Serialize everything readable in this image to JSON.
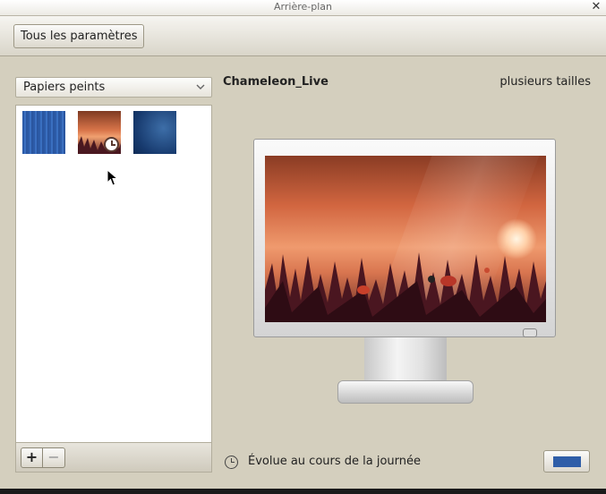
{
  "window": {
    "title": "Arrière-plan"
  },
  "toolbar": {
    "all_settings_label": "Tous les paramètres"
  },
  "sidebar": {
    "category_selected": "Papiers peints",
    "thumbnails": [
      {
        "name": "blue-stripes-wallpaper"
      },
      {
        "name": "chameleon-live-wallpaper",
        "selected": true,
        "time_based": true
      },
      {
        "name": "blue-night-wallpaper"
      }
    ],
    "add_label": "+",
    "remove_label": "−"
  },
  "preview": {
    "name": "Chameleon_Live",
    "size_text": "plusieurs tailles",
    "status_text": "Évolue au cours de la journée",
    "status_icon": "clock-icon"
  },
  "colors": {
    "accent_color": "#2f5ea8"
  }
}
